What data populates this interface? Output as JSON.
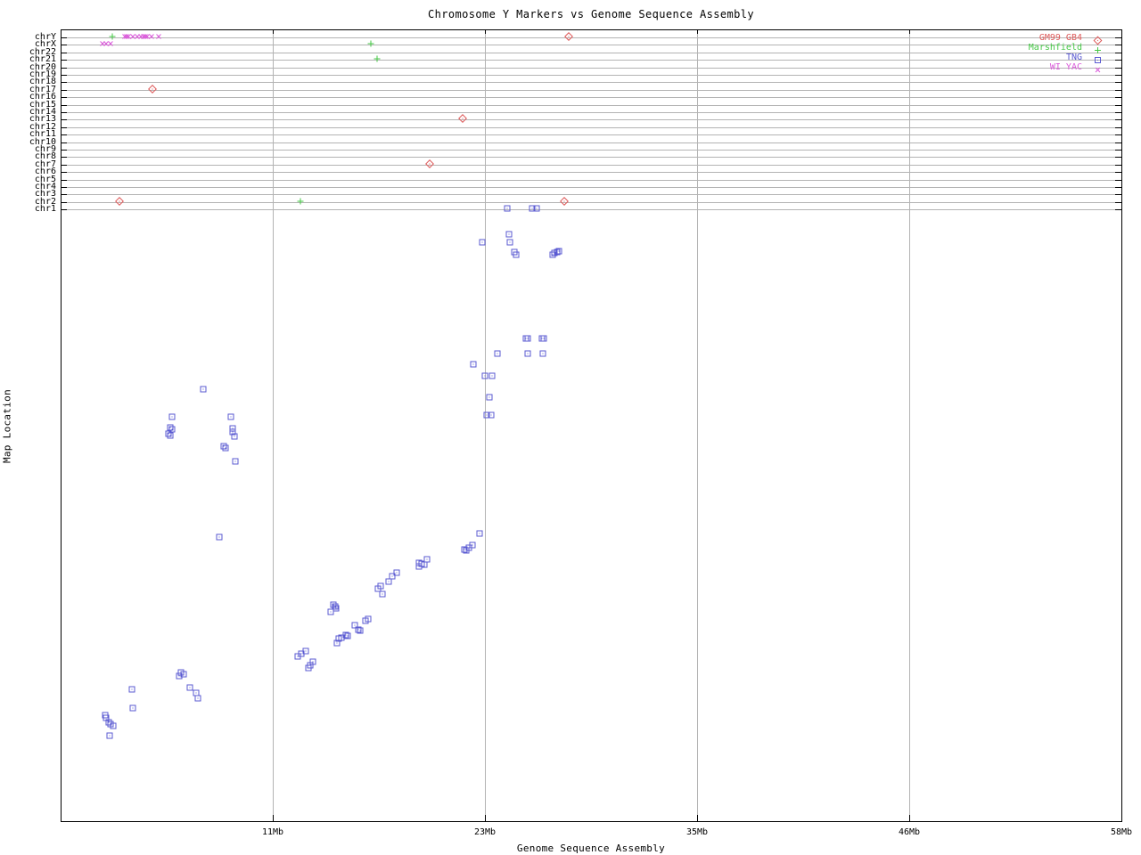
{
  "chart_data": {
    "type": "scatter",
    "title": "Chromosome Y Markers vs Genome Sequence Assembly",
    "xlabel": "Genome Sequence Assembly",
    "ylabel": "Map Location",
    "x_range_mb": [
      0,
      58
    ],
    "x_ticks": [
      {
        "label": "11Mb",
        "frac": 0.2
      },
      {
        "label": "23Mb",
        "frac": 0.4
      },
      {
        "label": "35Mb",
        "frac": 0.6
      },
      {
        "label": "46Mb",
        "frac": 0.8
      },
      {
        "label": "58Mb",
        "frac": 1.0
      }
    ],
    "grid": true,
    "legend_position": "top-right",
    "y_rows": [
      "chrY",
      "chrX",
      "chr22",
      "chr21",
      "chr20",
      "chr19",
      "chr18",
      "chr17",
      "chr16",
      "chr15",
      "chr14",
      "chr13",
      "chr12",
      "chr11",
      "chr10",
      "chr9",
      "chr8",
      "chr7",
      "chr6",
      "chr5",
      "chr4",
      "chr3",
      "chr2",
      "chr1"
    ],
    "band_note": "large lower band = chrY map location; loc = percent of band height, 0 = bottom axis, 100 = band top",
    "point_format": "[x_mb, loc_percent]",
    "series": [
      {
        "name": "GM99 GB4",
        "key": "gm99-gb4",
        "marker": "diamond",
        "color": "#de5a5a",
        "row_points": [
          {
            "chr": "chrY",
            "mb": [
              27.8
            ]
          },
          {
            "chr": "chr17",
            "mb": [
              5.0
            ]
          },
          {
            "chr": "chr13",
            "mb": [
              22.0
            ]
          },
          {
            "chr": "chr7",
            "mb": [
              20.2
            ]
          },
          {
            "chr": "chr2",
            "mb": [
              3.2,
              27.55
            ]
          }
        ],
        "band_points": []
      },
      {
        "name": "Marshfield",
        "key": "marshfield",
        "marker": "plus",
        "color": "#46c846",
        "row_points": [
          {
            "chr": "chrY",
            "mb": [
              2.85
            ]
          },
          {
            "chr": "chrX",
            "mb": [
              16.95
            ]
          },
          {
            "chr": "chr21",
            "mb": [
              17.3
            ]
          },
          {
            "chr": "chr2",
            "mb": [
              13.1
            ]
          }
        ],
        "band_points": []
      },
      {
        "name": "TNG",
        "key": "tng",
        "marker": "square",
        "color": "#5a5ad2",
        "row_points": [
          {
            "chr": "chr1",
            "mb": [
              24.4,
              25.8,
              26.05
            ]
          }
        ],
        "band_points": [
          [
            6.58,
            24.7
          ],
          [
            6.73,
            24.4
          ],
          [
            6.48,
            24.1
          ],
          [
            7.07,
            22.2
          ],
          [
            7.41,
            21.3
          ],
          [
            7.51,
            20.4
          ],
          [
            3.9,
            21.9
          ],
          [
            3.95,
            18.8
          ],
          [
            2.44,
            17.6
          ],
          [
            2.49,
            17.2
          ],
          [
            2.63,
            16.4
          ],
          [
            2.73,
            16.1
          ],
          [
            2.88,
            15.9
          ],
          [
            2.68,
            14.2
          ],
          [
            18.38,
            41.3
          ],
          [
            18.13,
            40.7
          ],
          [
            17.94,
            39.9
          ],
          [
            17.5,
            39.1
          ],
          [
            17.35,
            38.7
          ],
          [
            17.6,
            37.8
          ],
          [
            14.91,
            36.0
          ],
          [
            15.01,
            35.7
          ],
          [
            15.06,
            35.4
          ],
          [
            14.77,
            34.8
          ],
          [
            16.82,
            33.6
          ],
          [
            16.67,
            33.3
          ],
          [
            16.08,
            32.6
          ],
          [
            16.28,
            31.9
          ],
          [
            16.38,
            31.7
          ],
          [
            15.6,
            31.0
          ],
          [
            15.69,
            30.8
          ],
          [
            15.35,
            30.5
          ],
          [
            15.21,
            30.4
          ],
          [
            15.11,
            29.6
          ],
          [
            13.4,
            28.3
          ],
          [
            13.16,
            27.9
          ],
          [
            12.96,
            27.4
          ],
          [
            13.79,
            26.5
          ],
          [
            13.65,
            25.9
          ],
          [
            13.55,
            25.5
          ],
          [
            22.91,
            47.9
          ],
          [
            22.52,
            45.9
          ],
          [
            22.32,
            45.5
          ],
          [
            22.08,
            45.2
          ],
          [
            22.18,
            45.0
          ],
          [
            20.03,
            43.6
          ],
          [
            19.59,
            43.0
          ],
          [
            19.74,
            42.8
          ],
          [
            19.89,
            42.7
          ],
          [
            19.59,
            42.4
          ],
          [
            23.05,
            96.3
          ],
          [
            24.52,
            97.6
          ],
          [
            24.57,
            96.3
          ],
          [
            24.81,
            94.7
          ],
          [
            24.91,
            94.2
          ],
          [
            26.91,
            94.2
          ],
          [
            27.0,
            94.5
          ],
          [
            27.15,
            94.7
          ],
          [
            27.25,
            94.8
          ],
          [
            25.44,
            80.3
          ],
          [
            25.54,
            80.3
          ],
          [
            26.32,
            80.3
          ],
          [
            26.42,
            80.3
          ],
          [
            23.88,
            77.8
          ],
          [
            25.54,
            77.8
          ],
          [
            26.37,
            77.8
          ],
          [
            22.57,
            76.0
          ],
          [
            23.2,
            74.1
          ],
          [
            23.59,
            74.1
          ],
          [
            23.44,
            70.5
          ],
          [
            23.3,
            67.6
          ],
          [
            23.54,
            67.6
          ],
          [
            7.8,
            71.9
          ],
          [
            6.09,
            67.3
          ],
          [
            5.99,
            65.5
          ],
          [
            6.09,
            65.2
          ],
          [
            5.9,
            64.4
          ],
          [
            5.99,
            64.1
          ],
          [
            9.31,
            67.3
          ],
          [
            9.41,
            65.3
          ],
          [
            9.41,
            64.7
          ],
          [
            9.5,
            64.0
          ],
          [
            8.92,
            62.4
          ],
          [
            9.02,
            62.1
          ],
          [
            9.55,
            59.9
          ],
          [
            8.68,
            47.3
          ]
        ]
      },
      {
        "name": "WI YAC",
        "key": "wi-yac",
        "marker": "x",
        "color": "#da5ada",
        "row_points": [
          {
            "chr": "chrY",
            "mb": [
              3.5,
              3.6,
              3.7,
              3.95,
              4.2,
              4.4,
              4.55,
              4.65,
              4.75,
              4.95,
              5.35
            ]
          },
          {
            "chr": "chrX",
            "mb": [
              2.3,
              2.5,
              2.75
            ]
          }
        ],
        "band_points": []
      }
    ]
  },
  "colors": {
    "grid": "#b3b3b3",
    "axis": "#000000",
    "background": "#ffffff"
  }
}
